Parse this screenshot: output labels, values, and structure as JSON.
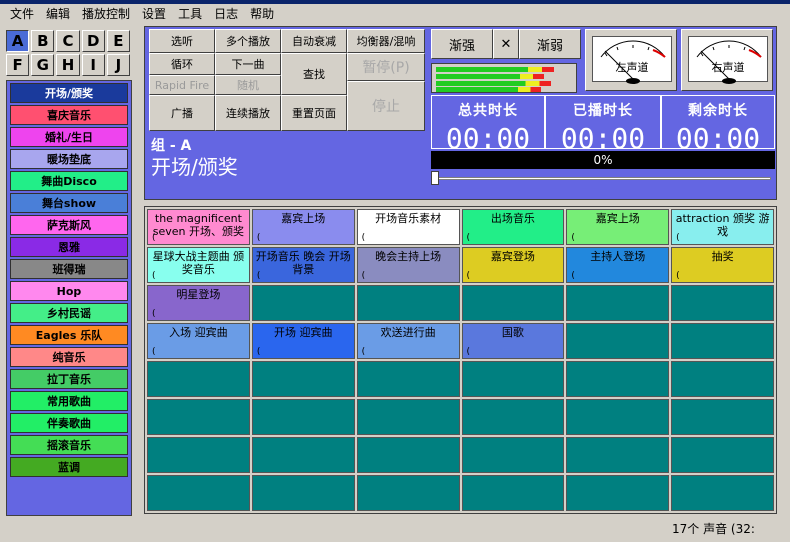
{
  "menu": [
    "文件",
    "编辑",
    "播放控制",
    "设置",
    "工具",
    "日志",
    "帮助"
  ],
  "letters": [
    {
      "label": "A",
      "active": true
    },
    {
      "label": "B"
    },
    {
      "label": "C"
    },
    {
      "label": "D"
    },
    {
      "label": "E"
    },
    {
      "label": "F"
    },
    {
      "label": "G"
    },
    {
      "label": "H"
    },
    {
      "label": "I"
    },
    {
      "label": "J"
    }
  ],
  "groups": [
    {
      "label": "开场/颁奖",
      "color": "#1a3a9c",
      "text": "#ffffff"
    },
    {
      "label": "喜庆音乐",
      "color": "#ff5070",
      "text": "#000000"
    },
    {
      "label": "婚礼/生日",
      "color": "#ee44ee",
      "text": "#000000"
    },
    {
      "label": "暖场垫底",
      "color": "#a8a6ee",
      "text": "#000000"
    },
    {
      "label": "舞曲Disco",
      "color": "#22ee88",
      "text": "#000000"
    },
    {
      "label": "舞台show",
      "color": "#4a7fd8",
      "text": "#000000"
    },
    {
      "label": "萨克斯风",
      "color": "#ff66ee",
      "text": "#000000"
    },
    {
      "label": "恩雅",
      "color": "#8a2ae6",
      "text": "#000000"
    },
    {
      "label": "班得瑞",
      "color": "#888888",
      "text": "#000000"
    },
    {
      "label": "Hop",
      "color": "#ff88ee",
      "text": "#000000"
    },
    {
      "label": "乡村民谣",
      "color": "#44ee88",
      "text": "#000000"
    },
    {
      "label": "Eagles 乐队",
      "color": "#ff8a22",
      "text": "#000000"
    },
    {
      "label": "纯音乐",
      "color": "#ff8888",
      "text": "#000000"
    },
    {
      "label": "拉丁音乐",
      "color": "#44cc66",
      "text": "#000000"
    },
    {
      "label": "常用歌曲",
      "color": "#22ee66",
      "text": "#000000"
    },
    {
      "label": "伴奏歌曲",
      "color": "#22ee66",
      "text": "#000000"
    },
    {
      "label": "摇滚音乐",
      "color": "#44dd55",
      "text": "#000000"
    },
    {
      "label": "蓝调",
      "color": "#44aa22",
      "text": "#000000"
    }
  ],
  "controls": {
    "select": "选听",
    "multi": "多个播放",
    "auto_fade": "自动衰减",
    "equalizer": "均衡器/混响",
    "loop": "循环",
    "next": "下一曲",
    "rapid_fire": "Rapid Fire",
    "random": "随机",
    "search": "查找",
    "pause": "暂停(P)",
    "broadcast": "广播",
    "continuous": "连续播放",
    "reset_page": "重置页面",
    "stop": "停止",
    "fade_in": "渐强",
    "close": "✕",
    "fade_out": "渐弱"
  },
  "meters": {
    "left": "左声道",
    "right": "右声道"
  },
  "levels": [
    0.92,
    0.84,
    0.9,
    0.82
  ],
  "timers": [
    {
      "title": "总共时长",
      "value": "00:00"
    },
    {
      "title": "已播时长",
      "value": "00:00"
    },
    {
      "title": "剩余时长",
      "value": "00:00"
    }
  ],
  "group_label": "组 - A",
  "group_name": "开场/颁奖",
  "progress": "0%",
  "sounds": [
    {
      "text": "the magnificent seven 开场、颁奖",
      "color": "#ff8ad0",
      "mark": "("
    },
    {
      "text": "嘉宾上场",
      "color": "#8a8cee",
      "mark": "("
    },
    {
      "text": "开场音乐素材",
      "color": "#ffffff",
      "mark": "("
    },
    {
      "text": "出场音乐",
      "color": "#22ee88",
      "mark": "("
    },
    {
      "text": "嘉宾上场",
      "color": "#77ee77",
      "mark": "("
    },
    {
      "text": "attraction 颁奖 游戏",
      "color": "#88eeee",
      "mark": "("
    },
    {
      "text": "星球大战主题曲 颁奖音乐",
      "color": "#88ffee",
      "mark": "("
    },
    {
      "text": "开场音乐 晚会 开场背景",
      "color": "#3a66dd",
      "mark": "("
    },
    {
      "text": "晚会主持上场",
      "color": "#8a8cc0",
      "mark": "("
    },
    {
      "text": "嘉宾登场",
      "color": "#ddcc22",
      "mark": "("
    },
    {
      "text": "主持人登场",
      "color": "#2288dd",
      "mark": "("
    },
    {
      "text": "抽奖",
      "color": "#ddcc22",
      "mark": "("
    },
    {
      "text": "明星登场",
      "color": "#8866cc",
      "mark": "("
    },
    {
      "text": "",
      "color": "",
      "mark": ""
    },
    {
      "text": "",
      "color": "",
      "mark": ""
    },
    {
      "text": "",
      "color": "",
      "mark": ""
    },
    {
      "text": "",
      "color": "",
      "mark": ""
    },
    {
      "text": "",
      "color": "",
      "mark": ""
    },
    {
      "text": "入场 迎宾曲",
      "color": "#6a9ce6",
      "mark": "("
    },
    {
      "text": "开场 迎宾曲",
      "color": "#2a66ee",
      "mark": "("
    },
    {
      "text": "欢送进行曲",
      "color": "#6a9ce6",
      "mark": "("
    },
    {
      "text": "国歌",
      "color": "#5a78dd",
      "mark": "("
    }
  ],
  "status": "17个 声音 (32:"
}
